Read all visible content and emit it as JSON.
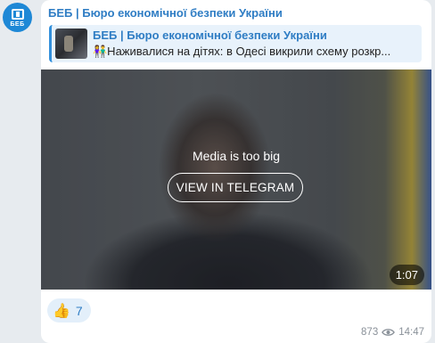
{
  "avatar": {
    "logo_text": "БЕБ"
  },
  "channel": {
    "name": "БЕБ | Бюро економічної безпеки України"
  },
  "forward": {
    "title": "БЕБ | Бюро економічної безпеки України",
    "preview": "👫Наживалися на дітях: в Одесі викрили схему розкр..."
  },
  "media": {
    "caption": "Media is too big",
    "button_label": "VIEW IN TELEGRAM",
    "duration": "1:07"
  },
  "reaction": {
    "emoji": "👍",
    "count": "7"
  },
  "meta": {
    "views": "873",
    "time": "14:47",
    "icon": "eye-icon"
  },
  "colors": {
    "accent": "#2f7dc4",
    "bubble": "#ffffff",
    "background": "#e7ebef"
  }
}
